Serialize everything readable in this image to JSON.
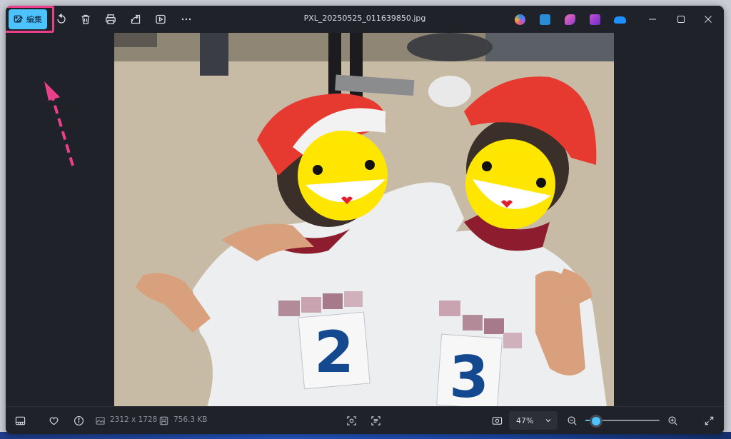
{
  "titlebar": {
    "edit_label": "編集",
    "filename": "PXL_20250525_011639850.jpg",
    "toolbar": [
      {
        "name": "rotate-icon"
      },
      {
        "name": "delete-icon"
      },
      {
        "name": "print-icon"
      },
      {
        "name": "share-icon"
      },
      {
        "name": "slideshow-icon"
      },
      {
        "name": "more-icon"
      }
    ],
    "app_icons": [
      {
        "name": "copilot-icon",
        "color": "#7b6cff"
      },
      {
        "name": "photo-editor-icon",
        "color": "#2b8cd6"
      },
      {
        "name": "clipchamp-icon",
        "color": "#c34fd6"
      },
      {
        "name": "video-editor-icon",
        "color": "#8a3ad0"
      },
      {
        "name": "onedrive-icon",
        "color": "#1e90ff"
      }
    ],
    "window_controls": [
      "minimize",
      "maximize",
      "close"
    ]
  },
  "photo": {
    "number_left": "2",
    "number_right": "3"
  },
  "bottombar": {
    "dimensions": "2312 x 1728",
    "file_size": "756.3 KB",
    "zoom_level": "47%",
    "zoom_slider_fraction": 0.12
  },
  "colors": {
    "accent": "#4cc2ff",
    "highlight": "#ea3f8a",
    "background": "#1f2329"
  }
}
